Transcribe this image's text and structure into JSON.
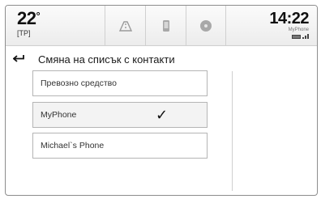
{
  "status": {
    "temperature": "22",
    "temperature_unit": "°",
    "climate_mode": "[TP]",
    "time": "14:22",
    "network_name": "MyPhone",
    "icons": [
      "navigation-icon",
      "phone-icon",
      "media-icon",
      "battery-icon",
      "signal-icon"
    ]
  },
  "header": {
    "title": "Смяна на списък с контакти"
  },
  "contact_lists": [
    {
      "label": "Превозно средство",
      "selected": false
    },
    {
      "label": "MyPhone",
      "selected": true
    },
    {
      "label": "Michael`s Phone",
      "selected": false
    }
  ],
  "check_mark": "✓"
}
